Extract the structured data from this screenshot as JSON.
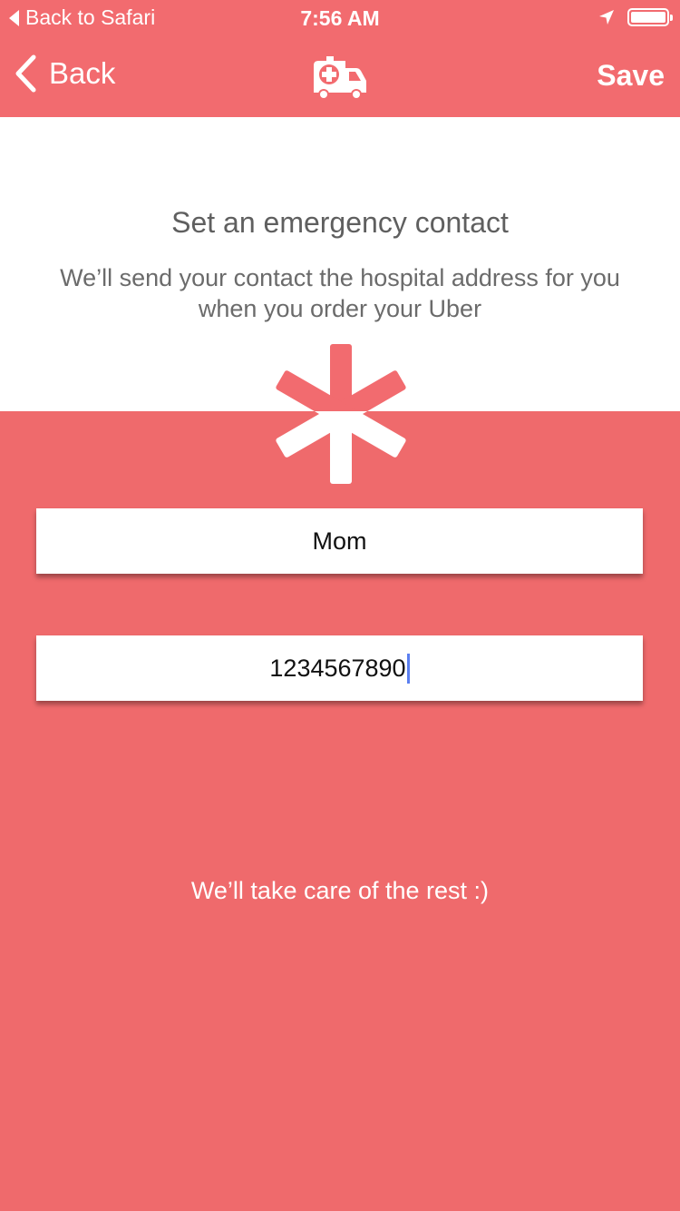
{
  "status_bar": {
    "back_label": "Back to Safari",
    "time": "7:56 AM"
  },
  "nav": {
    "back_label": "Back",
    "save_label": "Save",
    "logo_icon": "ambulance-icon"
  },
  "header": {
    "title": "Set an emergency contact",
    "subtitle": "We’ll send your contact the hospital address for you when you order your Uber"
  },
  "form": {
    "contact_name": "Mom",
    "contact_phone": "1234567890"
  },
  "footer": {
    "note": "We’ll take care of the rest :)"
  },
  "colors": {
    "brand": "#ef6a6c",
    "text_dark": "#5f5f5f",
    "caret": "#5b7ff0"
  }
}
